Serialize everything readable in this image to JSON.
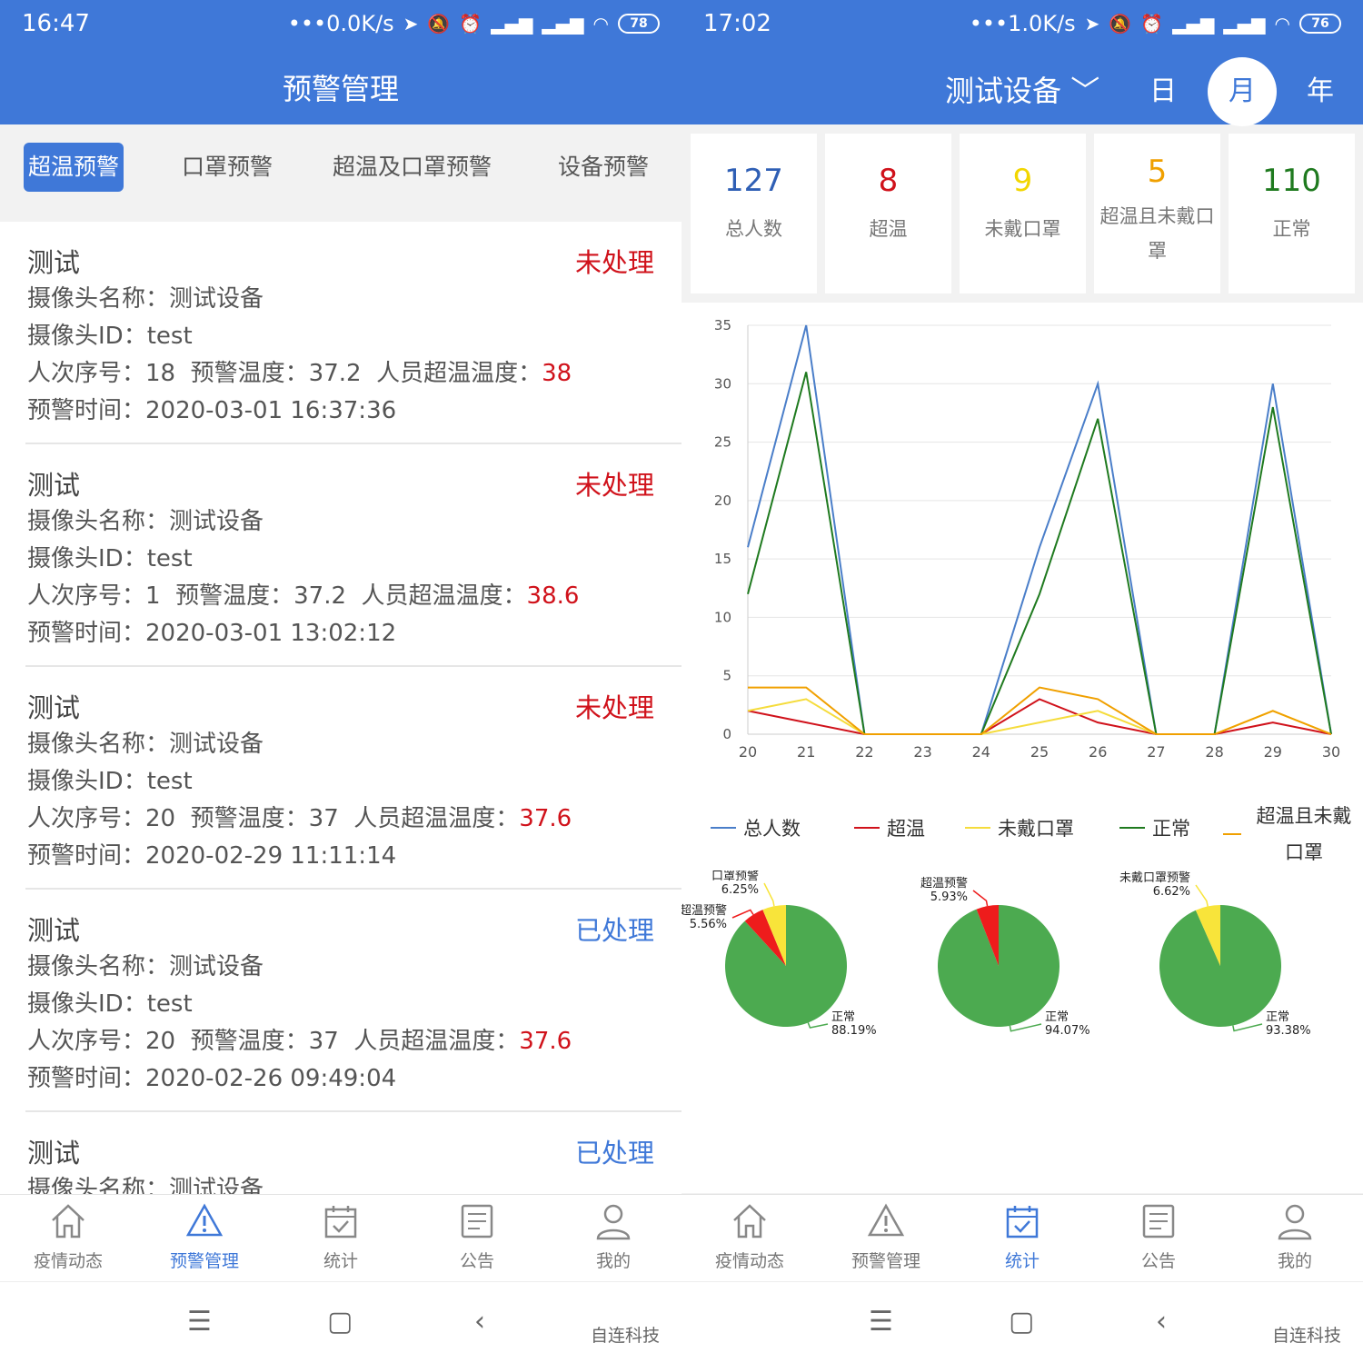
{
  "left": {
    "status": {
      "time": "16:47",
      "net": "0.0K/s",
      "battery": "78"
    },
    "title": "预警管理",
    "tabs": [
      {
        "label": "超温预警",
        "active": true
      },
      {
        "label": "口罩预警",
        "active": false
      },
      {
        "label": "超温及口罩预警",
        "active": false
      },
      {
        "label": "设备预警",
        "active": false
      }
    ],
    "alerts": [
      {
        "title": "测试",
        "status": "未处理",
        "cam_name_label": "摄像头名称：",
        "cam_name": "测试设备",
        "cam_id_label": "摄像头ID：",
        "cam_id": "test",
        "seq_label": "人次序号：",
        "seq": "18",
        "warn_temp_label": "预警温度：",
        "warn_temp": "37.2",
        "over_temp_label": "人员超温温度：",
        "over_temp": "38",
        "time_label": "预警时间：",
        "time": "2020-03-01 16:37:36"
      },
      {
        "title": "测试",
        "status": "未处理",
        "cam_name_label": "摄像头名称：",
        "cam_name": "测试设备",
        "cam_id_label": "摄像头ID：",
        "cam_id": "test",
        "seq_label": "人次序号：",
        "seq": "1",
        "warn_temp_label": "预警温度：",
        "warn_temp": "37.2",
        "over_temp_label": "人员超温温度：",
        "over_temp": "38.6",
        "time_label": "预警时间：",
        "time": "2020-03-01 13:02:12"
      },
      {
        "title": "测试",
        "status": "未处理",
        "cam_name_label": "摄像头名称：",
        "cam_name": "测试设备",
        "cam_id_label": "摄像头ID：",
        "cam_id": "test",
        "seq_label": "人次序号：",
        "seq": "20",
        "warn_temp_label": "预警温度：",
        "warn_temp": "37",
        "over_temp_label": "人员超温温度：",
        "over_temp": "37.6",
        "time_label": "预警时间：",
        "time": "2020-02-29 11:11:14"
      },
      {
        "title": "测试",
        "status": "已处理",
        "cam_name_label": "摄像头名称：",
        "cam_name": "测试设备",
        "cam_id_label": "摄像头ID：",
        "cam_id": "test",
        "seq_label": "人次序号：",
        "seq": "20",
        "warn_temp_label": "预警温度：",
        "warn_temp": "37",
        "over_temp_label": "人员超温温度：",
        "over_temp": "37.6",
        "time_label": "预警时间：",
        "time": "2020-02-26 09:49:04"
      },
      {
        "title": "测试",
        "status": "已处理",
        "cam_name_label": "摄像头名称：",
        "cam_name": "测试设备"
      }
    ]
  },
  "right": {
    "status": {
      "time": "17:02",
      "net": "1.0K/s",
      "battery": "76"
    },
    "device": "测试设备",
    "periods": [
      {
        "label": "日",
        "active": false
      },
      {
        "label": "月",
        "active": true
      },
      {
        "label": "年",
        "active": false
      }
    ],
    "cards": [
      {
        "value": "127",
        "label": "总人数",
        "color": "#2f5fb5"
      },
      {
        "value": "8",
        "label": "超温",
        "color": "#d0121b"
      },
      {
        "value": "9",
        "label": "未戴口罩",
        "color": "#f2d600"
      },
      {
        "value": "5",
        "label": "超温且未戴口罩",
        "color": "#f0a000"
      },
      {
        "value": "110",
        "label": "正常",
        "color": "#1f7a1f"
      }
    ]
  },
  "tabbar": [
    {
      "label": "疫情动态",
      "icon": "home-icon"
    },
    {
      "label": "预警管理",
      "icon": "warning-icon"
    },
    {
      "label": "统计",
      "icon": "calendar-check-icon"
    },
    {
      "label": "公告",
      "icon": "document-icon"
    },
    {
      "label": "我的",
      "icon": "user-icon"
    }
  ],
  "watermark": "自连科技",
  "chart_data": [
    {
      "type": "line",
      "x": [
        20,
        21,
        22,
        23,
        24,
        25,
        26,
        27,
        28,
        29,
        30
      ],
      "ylim": [
        0,
        35
      ],
      "yticks": [
        0,
        5,
        10,
        15,
        20,
        25,
        30,
        35
      ],
      "grid": true,
      "legend_position": "bottom",
      "series": [
        {
          "name": "总人数",
          "color": "#4a7ec9",
          "values": [
            16,
            35,
            0,
            0,
            0,
            16,
            30,
            0,
            0,
            30,
            0
          ]
        },
        {
          "name": "超温",
          "color": "#d0121b",
          "values": [
            2,
            1,
            0,
            0,
            0,
            3,
            1,
            0,
            0,
            1,
            0
          ]
        },
        {
          "name": "未戴口罩",
          "color": "#f5dc3c",
          "values": [
            2,
            3,
            0,
            0,
            0,
            1,
            2,
            0,
            0,
            2,
            0
          ]
        },
        {
          "name": "正常",
          "color": "#1f7a1f",
          "values": [
            12,
            31,
            0,
            0,
            0,
            12,
            27,
            0,
            0,
            28,
            0
          ]
        },
        {
          "name": "超温且未戴口罩",
          "color": "#f0a000",
          "values": [
            4,
            4,
            0,
            0,
            0,
            4,
            3,
            0,
            0,
            2,
            0
          ]
        }
      ]
    },
    {
      "type": "pie",
      "slices": [
        {
          "label": "正常",
          "value": 88.19,
          "display": "88.19%",
          "color": "#4caa50"
        },
        {
          "label": "超温预警",
          "value": 5.56,
          "display": "5.56%",
          "color": "#ee1c1c"
        },
        {
          "label": "口罩预警",
          "value": 6.25,
          "display": "6.25%",
          "color": "#f8e43a"
        }
      ]
    },
    {
      "type": "pie",
      "slices": [
        {
          "label": "正常",
          "value": 94.07,
          "display": "94.07%",
          "color": "#4caa50"
        },
        {
          "label": "超温预警",
          "value": 5.93,
          "display": "5.93%",
          "color": "#ee1c1c"
        }
      ]
    },
    {
      "type": "pie",
      "slices": [
        {
          "label": "正常",
          "value": 93.38,
          "display": "93.38%",
          "color": "#4caa50"
        },
        {
          "label": "未戴口罩预警",
          "value": 6.62,
          "display": "6.62%",
          "color": "#f8e43a"
        }
      ]
    }
  ]
}
